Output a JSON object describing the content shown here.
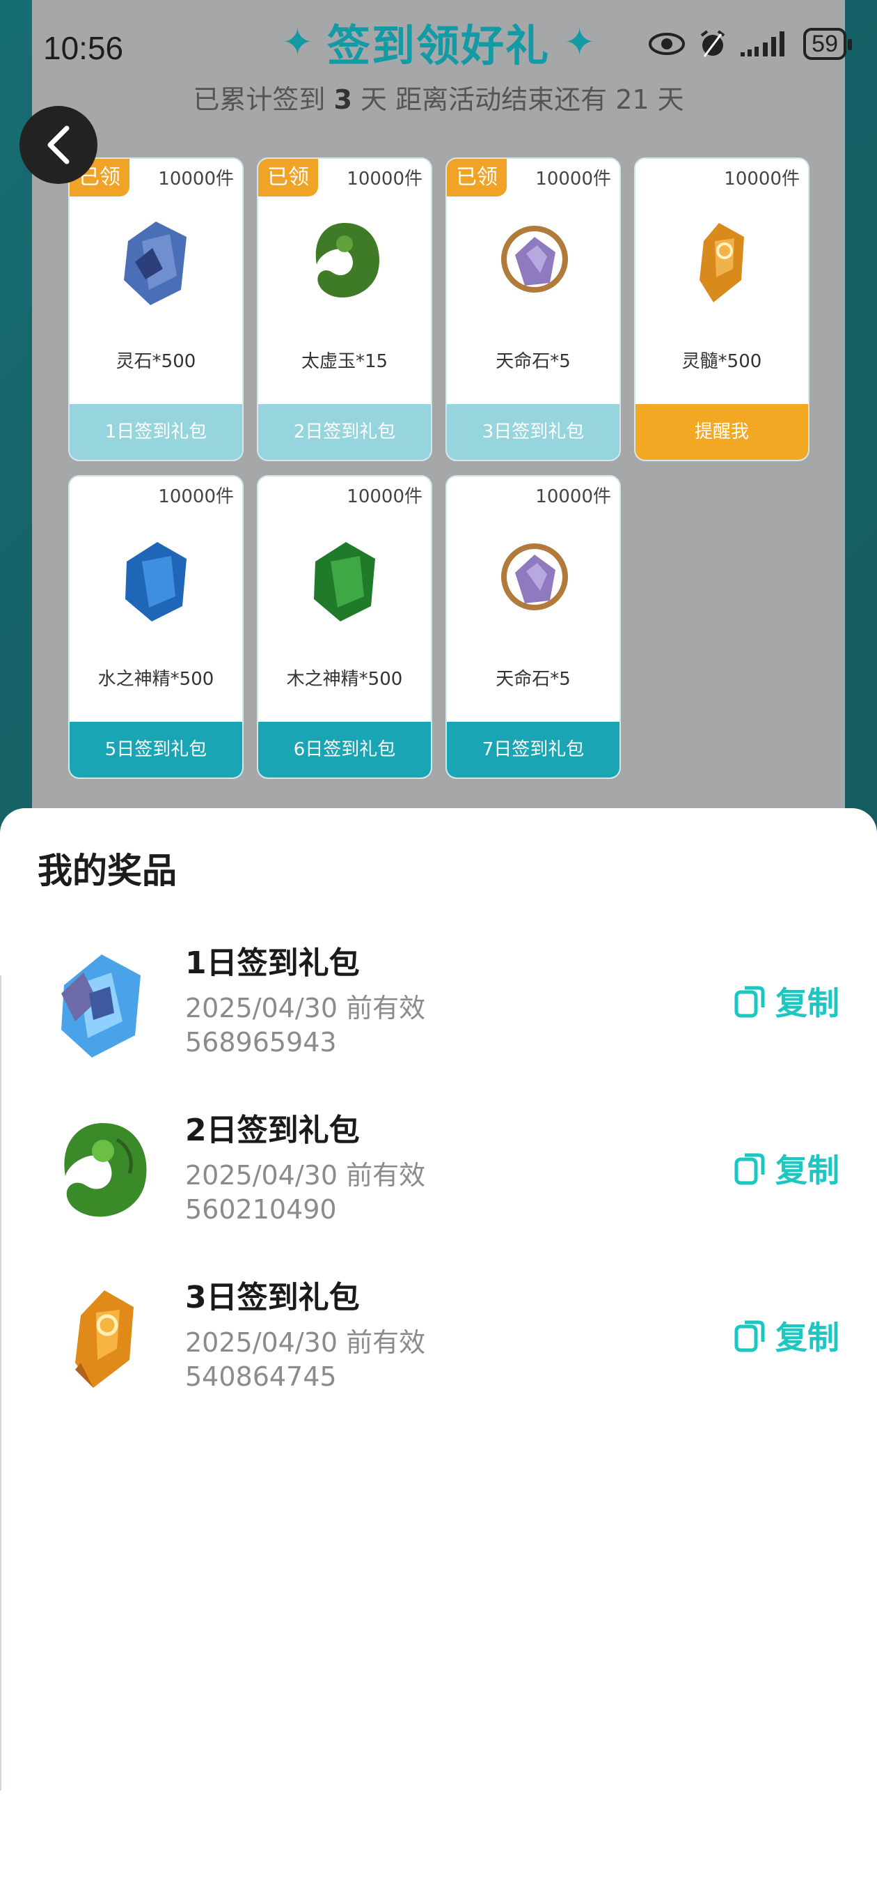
{
  "status_bar": {
    "time": "10:56",
    "battery": "59"
  },
  "header": {
    "title": "签到领好礼",
    "subtitle_prefix": "已累计签到",
    "signed_days": "3",
    "subtitle_mid": "天  距离活动结束还有 21 天"
  },
  "cards": [
    {
      "count": "10000件",
      "name": "灵石*500",
      "button": "1日签到礼包",
      "claimed": "已领",
      "state": "claimed"
    },
    {
      "count": "10000件",
      "name": "太虚玉*15",
      "button": "2日签到礼包",
      "claimed": "已领",
      "state": "claimed"
    },
    {
      "count": "10000件",
      "name": "天命石*5",
      "button": "3日签到礼包",
      "claimed": "已领",
      "state": "claimed"
    },
    {
      "count": "10000件",
      "name": "灵髓*500",
      "button": "提醒我",
      "state": "remind"
    },
    {
      "count": "10000件",
      "name": "水之神精*500",
      "button": "5日签到礼包",
      "state": "pending"
    },
    {
      "count": "10000件",
      "name": "木之神精*500",
      "button": "6日签到礼包",
      "state": "pending"
    },
    {
      "count": "10000件",
      "name": "天命石*5",
      "button": "7日签到礼包",
      "state": "pending"
    }
  ],
  "sheet": {
    "title": "我的奖品",
    "copy_label": "复制",
    "prizes": [
      {
        "name": "1日签到礼包",
        "expiry": "2025/04/30 前有效",
        "code": "568965943",
        "icon": "blue-crystal-icon"
      },
      {
        "name": "2日签到礼包",
        "expiry": "2025/04/30 前有效",
        "code": "560210490",
        "icon": "green-jade-icon"
      },
      {
        "name": "3日签到礼包",
        "expiry": "2025/04/30 前有效",
        "code": "540864745",
        "icon": "amber-crystal-icon"
      }
    ]
  },
  "colors": {
    "accent": "#1cc7c2",
    "teal": "#139aa4",
    "orange": "#f3a823"
  }
}
